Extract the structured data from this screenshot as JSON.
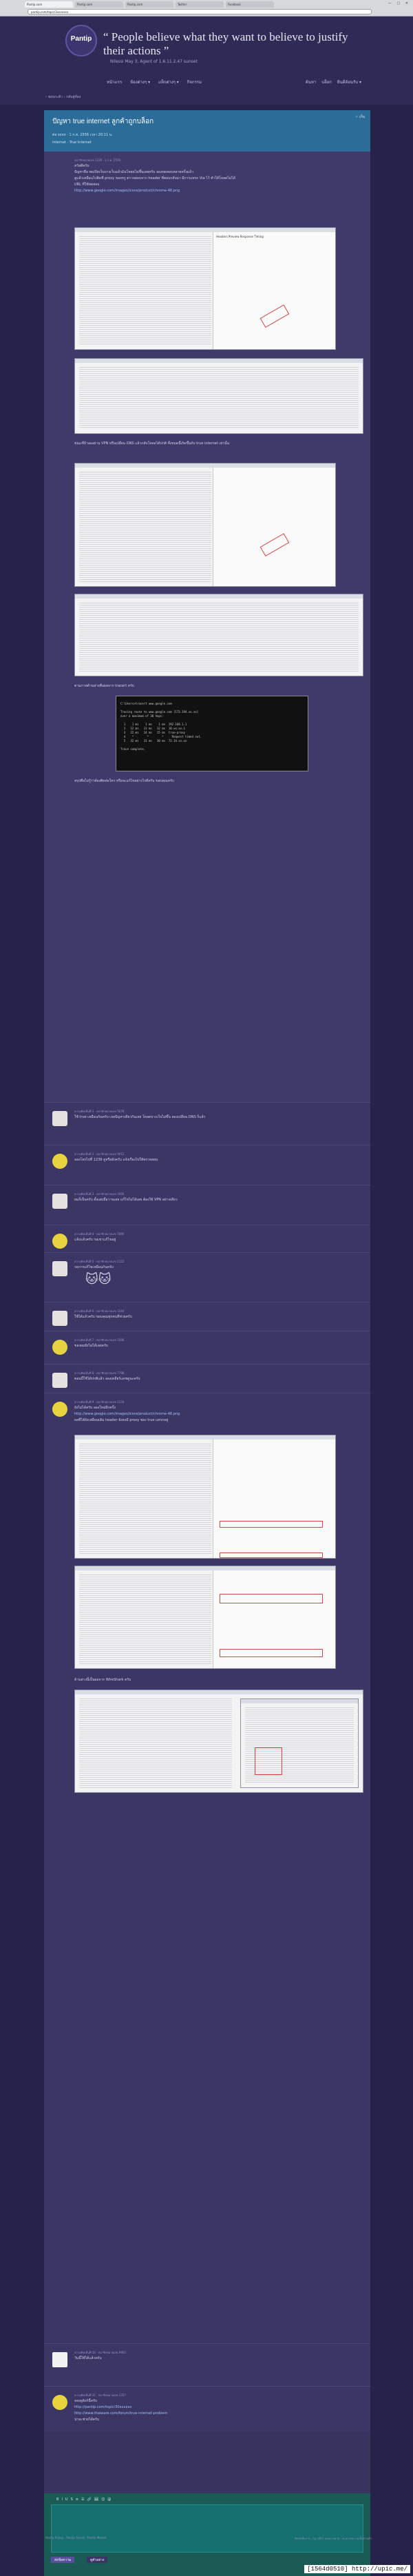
{
  "browser": {
    "tabs": [
      "Pantip.com",
      "Pantip.com",
      "Pantip.com",
      "Twitter",
      "Facebook"
    ],
    "url": "pantip.com/topic/3xxxxxxx",
    "win": "— ▢ ✕"
  },
  "header": {
    "logo": "Pantip",
    "quote": "“ People believe what they want to believe to justify their actions ”",
    "quote_by": "Nilessi May 3, Agent of 1.6.11.2.47 sunset",
    "nav": [
      "หน้าแรก",
      "ห้องต่างๆ ▾",
      "แท็กต่างๆ ▾",
      "กิจกรรม"
    ],
    "right_nav": [
      "ค้นหา",
      "บล็อก",
      "ยินดีต้อนรับ ▾"
    ]
  },
  "breadcrumb": "‹ ชอบกะต้ว › กลับสู่ห้อง",
  "topic": {
    "title": "ปัญหา true internet ลูกค้าถูกบล็อก",
    "meta": "ต่อ xxxx · 1 ก.ค. 2556 เวลา 20:11 น.",
    "tags": "Internet · True Internet",
    "bookmark": "☆ เก็บ"
  },
  "op": {
    "meta": "สมาชิกหมายเลข 1234 · 1 ก.ค. 2556",
    "p1": "สวัสดีครับ",
    "p2": "ปัญหาคือ พอเปิดเว็บบางเว็บแล้วมันโหลดไม่ขึ้นเลยครับ ลองทดสอบหลายครั้งแล้ว",
    "p3": "ดูแล้วเหมือนไปติดที่ proxy ของทรู ตรวจสอบจาก header ที่ตอบกลับมา มีการแทรก Via ไว้ ทำให้โหลดไม่ได้",
    "link_label": "URL ที่ใช้ทดสอบ",
    "link": "http://www.google.com/images/icons/product/chrome-48.png",
    "p4": "ขณะที่ถ้าลองผ่าน VPN หรือเปลี่ยน DNS แล้วกลับโหลดได้ปกติ ทั้งหมดนี้เกิดขึ้นกับ true internet เท่านั้น",
    "p5": "ตามภาพด้านล่างคือผลจาก tracert ครับ",
    "p6": "สรุปคือไม่รู้ว่าต้องติดต่อใคร หรือจะแก้ไขอย่างไรดีครับ ขอบคุณครับ",
    "shot_title": "Headers  Preview  Response  Timing",
    "terminal": "C:\\Users>tracert www.google.com\n\nTracing route to www.google.com [173.194.xx.xx]\nover a maximum of 30 hops:\n\n  1    1 ms    1 ms    1 ms  192.168.1.1\n  2   12 ms   11 ms   12 ms  10.xx.xx.1\n  3   15 ms   14 ms   15 ms  true-proxy\n  4    *        *        *     Request timed out.\n  5   32 ms   31 ms   30 ms  72.14.xx.xx\n\nTrace complete."
  },
  "posts": [
    {
      "avatar": "p",
      "meta": "ความคิดเห็นที่ 1 · สมาชิกหมายเลข 5678",
      "text": "ใช้ true เหมือนกันครับ เจอปัญหาเดียวกันเลย โหลดบางเว็บไม่ขึ้น ลองเปลี่ยน DNS ก็แล้ว",
      "h": 62
    },
    {
      "avatar": "y",
      "meta": "ความคิดเห็นที่ 2 · สมาชิกหมายเลข 9012",
      "text": "ลองโทรไปที่ 1239 ดูหรือยังครับ แจ้งเรื่องไปให้ตรวจสอบ",
      "h": 58
    },
    {
      "avatar": "p",
      "meta": "ความคิดเห็นที่ 3 · สมาชิกหมายเลข 3456",
      "text": "ผมก็เป็นครับ ตั้งแต่เมื่อวานเลย แก้ไขไม่ได้เลย ต้องใช้ VPN อย่างเดียว",
      "h": 58
    },
    {
      "avatar": "y",
      "meta": "ความคิดเห็นที่ 4 · สมาชิกหมายเลข 7890",
      "text": "แจ้งแล้วครับ รอเขาแก้ไขอยู่",
      "h": 40
    },
    {
      "avatar": "p",
      "meta": "ความคิดเห็นที่ 5 · สมาชิกหมายเลข 1122",
      "text": "รอการแก้ไขเหมือนกันครับ",
      "h": 72
    },
    {
      "avatar": "p",
      "meta": "ความคิดเห็นที่ 6 · สมาชิกหมายเลข 3344",
      "text": "ใช้ได้แล้วครับ ขอบคุณทุกคนที่ช่วยครับ",
      "h": 42
    },
    {
      "avatar": "y",
      "meta": "ความคิดเห็นที่ 7 · สมาชิกหมายเลข 5566",
      "text": "ของผมยังไม่ได้เลยครับ",
      "h": 48
    },
    {
      "avatar": "p",
      "meta": "ความคิดเห็นที่ 8 · สมาชิกหมายเลข 7788",
      "text": "ตอนนี้ใช้ได้ปกติแล้ว ลองเคลียร์แคชดูนะครับ",
      "h": 42
    }
  ],
  "long_post": {
    "meta": "ความคิดเห็นที่ 9 · สมาชิกหมายเลข 1234",
    "p1": "ยังไม่ได้ครับ ลองใหม่อีกครั้ง",
    "link": "http://www.google.com/images/icons/product/chrome-48.png",
    "p2": "ผลที่ได้ยังเหมือนเดิม header ยังคงมี proxy ของ true แทรกอยู่",
    "p3": "ด้านล่างนี้เป็นผลจาก WireShark ครับ"
  },
  "last_posts": [
    {
      "avatar": "w",
      "meta": "ความคิดเห็นที่ 10 · สมาชิกหมายเลข 9900",
      "text": "วันนี้ใช้ได้แล้วครับ",
      "h": 62
    },
    {
      "avatar": "y",
      "meta": "ความคิดเห็นที่ 11 · สมาชิกหมายเลข 1357",
      "text": "ลองดูลิงก์นี้ครับ",
      "link1": "http://pantip.com/topic/30xxxxxx",
      "link2": "http://www.thaiware.com/forum/true-internet-problem",
      "text2": "น่าจะช่วยได้ครับ",
      "h": 66
    }
  ],
  "reply": {
    "toolbar": [
      "B",
      "I",
      "U",
      "S",
      "≡",
      "☰",
      "🔗",
      "🖼",
      "☺",
      "@"
    ],
    "submit": "ส่งข้อความ",
    "preview": "ดูตัวอย่าง"
  },
  "footer": {
    "left": "Pantip Pickup · Pantip Trends · Pantip Market",
    "right": "ติดต่อทีมงาน · กฎ กติกา และมารยาท · นโยบายความเป็นส่วนตัว"
  },
  "watermark": "[1564d0510] http://upic.me/"
}
